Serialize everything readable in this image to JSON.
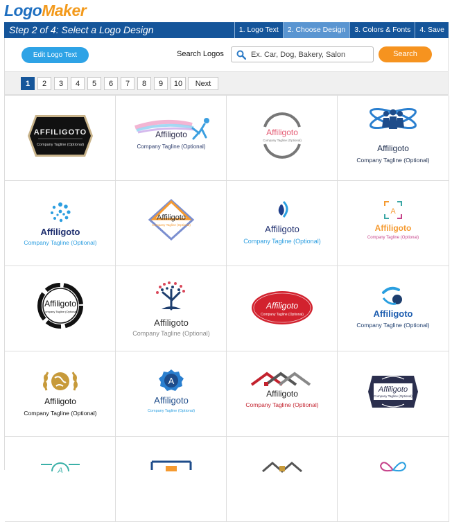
{
  "brand": {
    "part1": "Logo",
    "part2": "Maker"
  },
  "stepbar": {
    "title": "Step 2 of 4: Select a Logo Design",
    "steps": [
      "1. Logo Text",
      "2. Choose Design",
      "3. Colors & Fonts",
      "4. Save"
    ]
  },
  "toolbar": {
    "edit_label": "Edit Logo Text",
    "search_label": "Search Logos",
    "search_placeholder": "Ex. Car, Dog, Bakery, Salon",
    "search_button": "Search"
  },
  "pager": {
    "pages": [
      "1",
      "2",
      "3",
      "4",
      "5",
      "6",
      "7",
      "8",
      "9",
      "10"
    ],
    "next": "Next"
  },
  "logo": {
    "name": "Affiligoto",
    "name_upper": "AFFILIGOTO",
    "tagline": "Company Tagline (Optional)",
    "monogram": "A"
  },
  "colors": {
    "header_blue": "#15559a",
    "active_step": "#5a95d1",
    "edit_button": "#2ea3e6",
    "search_button": "#f6931f"
  },
  "icons": [
    "search-icon"
  ]
}
